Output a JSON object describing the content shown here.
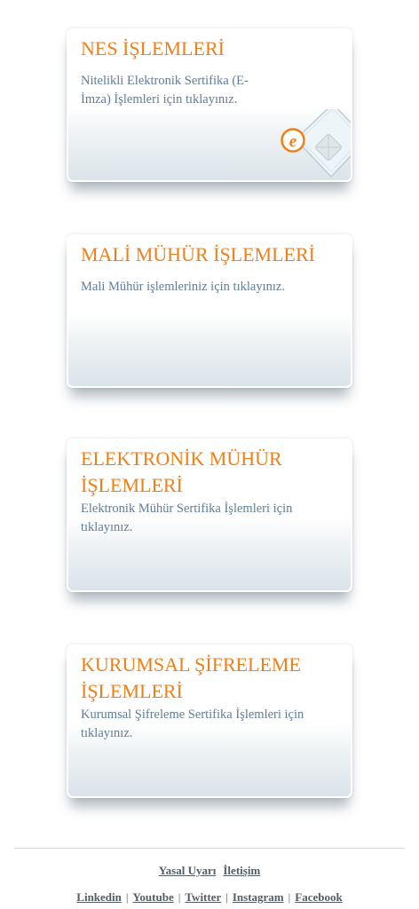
{
  "cards": [
    {
      "title": "NES İŞLEMLERİ",
      "description": "Nitelikli Elektronik Sertifika (E-İmza) İşlemleri için tıklayınız.",
      "icon": "e-signature-card-icon",
      "icon_letter": "e"
    },
    {
      "title": "MALİ MÜHÜR İŞLEMLERİ",
      "description": "Mali Mühür işlemleriniz için tıklayınız."
    },
    {
      "title": "ELEKTRONİK MÜHÜR İŞLEMLERİ",
      "description": "Elektronik Mühür Sertifika İşlemleri için tıklayınız."
    },
    {
      "title": "KURUMSAL ŞİFRELEME İŞLEMLERİ",
      "description": "Kurumsal Şifreleme Sertifika İşlemleri için tıklayınız."
    }
  ],
  "footer": {
    "primary_links": [
      "Yasal Uyarı",
      "İletişim"
    ],
    "social_links": [
      "Linkedin",
      "Youtube",
      "Twitter",
      "Instagram",
      "Facebook"
    ],
    "separator": "|"
  },
  "colors": {
    "title": "#ef7f1a",
    "description": "#5f7d98",
    "footer_text": "#555d64",
    "card_gradient_bottom": "#dbe4ea"
  }
}
